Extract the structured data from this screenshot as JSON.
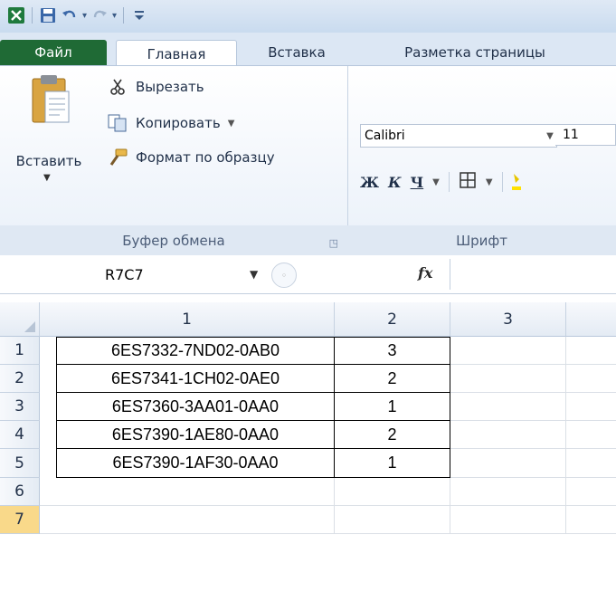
{
  "qat": {
    "undo_dropdown": "▾",
    "redo_dropdown": "▾"
  },
  "tabs": {
    "file": "Файл",
    "home": "Главная",
    "insert": "Вставка",
    "page_layout": "Разметка страницы"
  },
  "clipboard": {
    "paste": "Вставить",
    "cut": "Вырезать",
    "copy": "Копировать",
    "format_painter": "Формат по образцу",
    "group_label": "Буфер обмена"
  },
  "font": {
    "name": "Calibri",
    "size": "11",
    "bold": "Ж",
    "italic": "К",
    "underline": "Ч",
    "group_label": "Шрифт"
  },
  "formula_bar": {
    "name_box": "R7C7",
    "fx": "fx",
    "value": ""
  },
  "columns": [
    "1",
    "2",
    "3"
  ],
  "rows": [
    {
      "num": "1",
      "c1": "6ES7332-7ND02-0AB0",
      "c2": "3",
      "c3": ""
    },
    {
      "num": "2",
      "c1": "6ES7341-1CH02-0AE0",
      "c2": "2",
      "c3": ""
    },
    {
      "num": "3",
      "c1": "6ES7360-3AA01-0AA0",
      "c2": "1",
      "c3": ""
    },
    {
      "num": "4",
      "c1": "6ES7390-1AE80-0AA0",
      "c2": "2",
      "c3": ""
    },
    {
      "num": "5",
      "c1": "6ES7390-1AF30-0AA0",
      "c2": "1",
      "c3": ""
    },
    {
      "num": "6",
      "c1": "",
      "c2": "",
      "c3": ""
    },
    {
      "num": "7",
      "c1": "",
      "c2": "",
      "c3": ""
    }
  ],
  "selected_row": "7",
  "colors": {
    "file_tab": "#1f6a35",
    "selected_header": "#f9d98a"
  }
}
